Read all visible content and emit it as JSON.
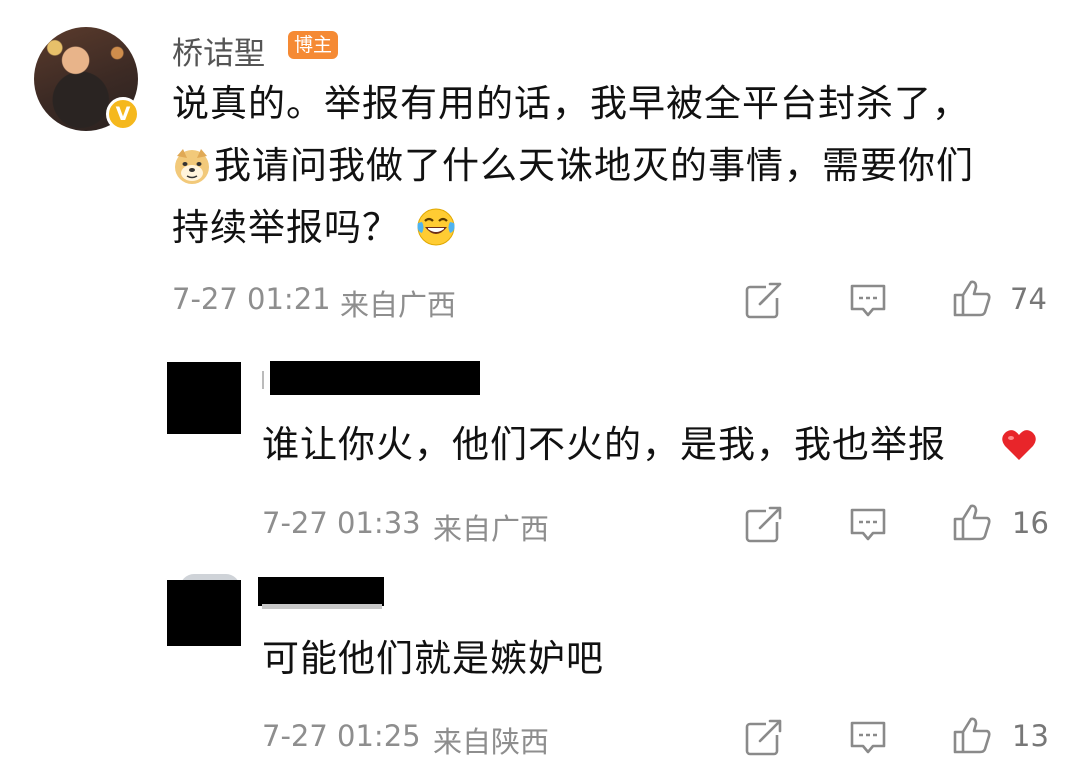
{
  "main_comment": {
    "username": "桥诘聖",
    "badge": "博主",
    "lines": [
      "说真的。举报有用的话，我早被全平台封杀了，",
      "我请问我做了什么天诛地灭的事情，需要你们",
      "持续举报吗？"
    ],
    "timestamp": "7-27 01:21",
    "location": "来自广西",
    "likes": "74"
  },
  "replies": [
    {
      "text": "谁让你火，他们不火的，是我，我也举报",
      "timestamp": "7-27 01:33",
      "location": "来自广西",
      "likes": "16"
    },
    {
      "text": "可能他们就是嫉妒吧",
      "timestamp": "7-27 01:25",
      "location": "来自陕西",
      "likes": "13"
    }
  ],
  "icons": {
    "forward": "share-icon",
    "comment": "comment-icon",
    "like": "thumbs-up-icon",
    "verified": "verified-v-icon",
    "doge": "doge-emoji",
    "laugh": "laugh-cry-emoji",
    "heart": "red-heart-emoji"
  },
  "colors": {
    "badge": "#f58a34",
    "verified": "#f5b81d",
    "meta": "#8e8e8e"
  }
}
